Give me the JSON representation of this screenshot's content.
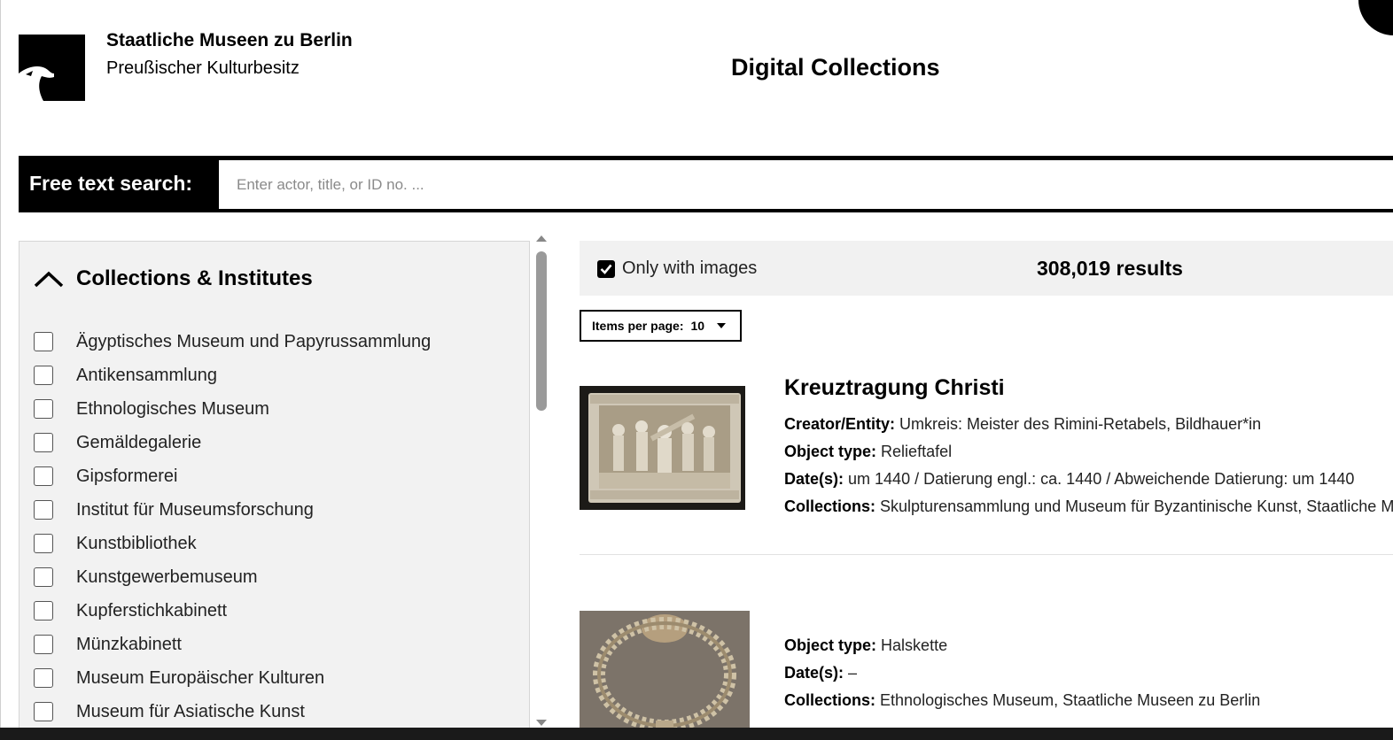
{
  "header": {
    "org_name": "Staatliche Museen zu Berlin",
    "org_subtitle": "Preußischer Kulturbesitz",
    "site_title": "Digital Collections"
  },
  "search": {
    "label": "Free text search:",
    "placeholder": "Enter actor, title, or ID no. ..."
  },
  "facets": {
    "title": "Collections & Institutes",
    "items": [
      {
        "label": "Ägyptisches Museum und Papyrussammlung"
      },
      {
        "label": "Antikensammlung"
      },
      {
        "label": "Ethnologisches Museum"
      },
      {
        "label": "Gemäldegalerie"
      },
      {
        "label": "Gipsformerei"
      },
      {
        "label": "Institut für Museumsforschung"
      },
      {
        "label": "Kunstbibliothek"
      },
      {
        "label": "Kunstgewerbemuseum"
      },
      {
        "label": "Kupferstichkabinett"
      },
      {
        "label": "Münzkabinett"
      },
      {
        "label": "Museum Europäischer Kulturen"
      },
      {
        "label": "Museum für Asiatische Kunst"
      }
    ]
  },
  "results": {
    "only_images_label": "Only with images",
    "only_images_checked": true,
    "count": "308,019 results",
    "items_per_page_label": "Items per page:",
    "items_per_page_value": "10",
    "items": [
      {
        "title": "Kreuztragung Christi",
        "creator_label": "Creator/Entity:",
        "creator": "Umkreis: Meister des Rimini-Retabels, Bildhauer*in",
        "object_type_label": "Object type:",
        "object_type": "Relieftafel",
        "dates_label": "Date(s):",
        "dates": "um 1440 / Datierung engl.: ca. 1440 / Abweichende Datierung: um 1440",
        "collections_label": "Collections:",
        "collections": "Skulpturensammlung und Museum für Byzantinische Kunst, Staatliche Museen zu Berlin"
      },
      {
        "object_type_label": "Object type:",
        "object_type": "Halskette",
        "dates_label": "Date(s):",
        "dates": "–",
        "collections_label": "Collections:",
        "collections": "Ethnologisches Museum, Staatliche Museen zu Berlin"
      }
    ]
  }
}
